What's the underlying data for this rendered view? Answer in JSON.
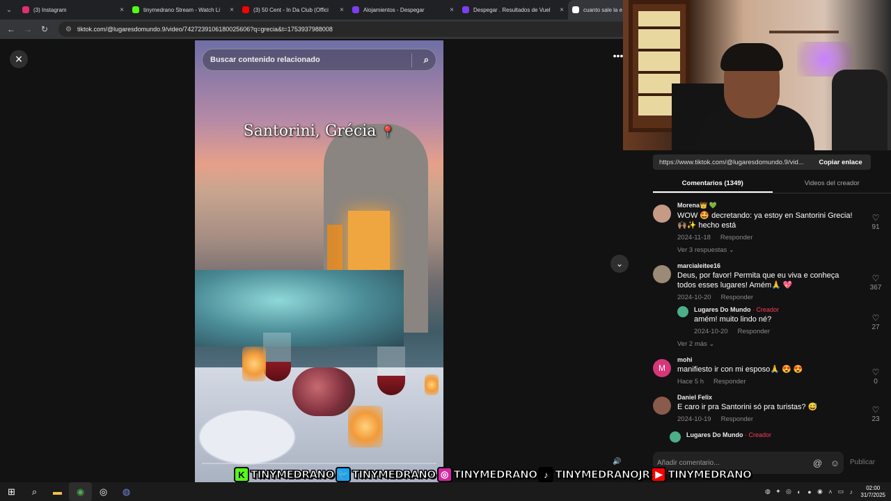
{
  "browser": {
    "tabs": [
      {
        "label": "(3) Instagram",
        "color": "#e1306c",
        "active": false
      },
      {
        "label": "tinymedrano Stream - Watch Li",
        "color": "#53fc18",
        "active": false
      },
      {
        "label": "(3) 50 Cent - In Da Club (Offici",
        "color": "#ff0000",
        "active": false
      },
      {
        "label": "Alojamientos - Despegar",
        "color": "#7b3ff2",
        "active": false
      },
      {
        "label": "Despegar . Resultados de Vuel",
        "color": "#7b3ff2",
        "active": false
      },
      {
        "label": "cuanto sale la e",
        "color": "#ffffff",
        "active": true
      }
    ],
    "url": "tiktok.com/@lugaresdomundo.9/video/7427239106180025606?q=grecia&t=1753937988008"
  },
  "video": {
    "search_placeholder": "Buscar contenido relacionado",
    "overlay_title": "Santorini, Grécia",
    "pin_glyph": "📍"
  },
  "panel": {
    "share_link": "https://www.tiktok.com/@lugaresdomundo.9/vid...",
    "copy_label": "Copiar enlace",
    "tabs": [
      "Comentarios (1349)",
      "Videos del creador"
    ],
    "comments": [
      {
        "name": "Morena👑 💚",
        "text": "WOW 🤩 decretando: ya estoy en Santorini Grecia! 🙌🏽✨ hecho está",
        "date": "2024-11-18",
        "reply_label": "Responder",
        "likes": "91",
        "more": "Ver 3 respuestas ⌄",
        "avatar_color": "#c79a86"
      },
      {
        "name": "marcialeitee16",
        "text": "Deus, por favor! Permita que eu viva e conheça todos esses lugares! Amém🙏 💖",
        "date": "2024-10-20",
        "reply_label": "Responder",
        "likes": "367",
        "avatar_color": "#9a8a76",
        "reply": {
          "name": "Lugares Do Mundo",
          "creator": " · Creador",
          "text": "amém! muito lindo né?",
          "date": "2024-10-20",
          "reply_label": "Responder",
          "likes": "27",
          "avatar_color": "#4caf88"
        },
        "more": "Ver 2 más ⌄"
      },
      {
        "name": "mohi",
        "text": "manifiesto ir con mi esposo🙏 😍 😍",
        "date": "Hace 5 h",
        "reply_label": "Responder",
        "likes": "0",
        "avatar_letter": "M",
        "avatar_color": "#d6367a"
      },
      {
        "name": "Daniel Felix",
        "text": "E caro ir pra Santorini só pra turistas? 😅",
        "date": "2024-10-19",
        "reply_label": "Responder",
        "likes": "23",
        "avatar_color": "#8a5a4a"
      }
    ],
    "next_preview": {
      "name": "Lugares Do Mundo",
      "creator": " · Creador"
    },
    "input_placeholder": "Añadir comentario...",
    "publish_label": "Publicar"
  },
  "social_strip": [
    {
      "platform": "kick-icon",
      "glyph": "K",
      "bg": "#53fc18",
      "fg": "#000000",
      "handle": "TINYMEDRANO"
    },
    {
      "platform": "twitter-icon",
      "glyph": "🐦",
      "bg": "#1da1f2",
      "fg": "#ffffff",
      "handle": "TINYMEDRANO"
    },
    {
      "platform": "instagram-icon",
      "glyph": "◎",
      "bg": "#d6249f",
      "fg": "#ffffff",
      "handle": "TINYMEDRANO"
    },
    {
      "platform": "tiktok-icon",
      "glyph": "♪",
      "bg": "#000000",
      "fg": "#ffffff",
      "handle": "TINYMEDRANOJR"
    },
    {
      "platform": "youtube-icon",
      "glyph": "▶",
      "bg": "#ff0000",
      "fg": "#ffffff",
      "handle": "TINYMEDRANO"
    }
  ],
  "taskbar": {
    "time": "02:00",
    "date": "31/7/2025"
  }
}
